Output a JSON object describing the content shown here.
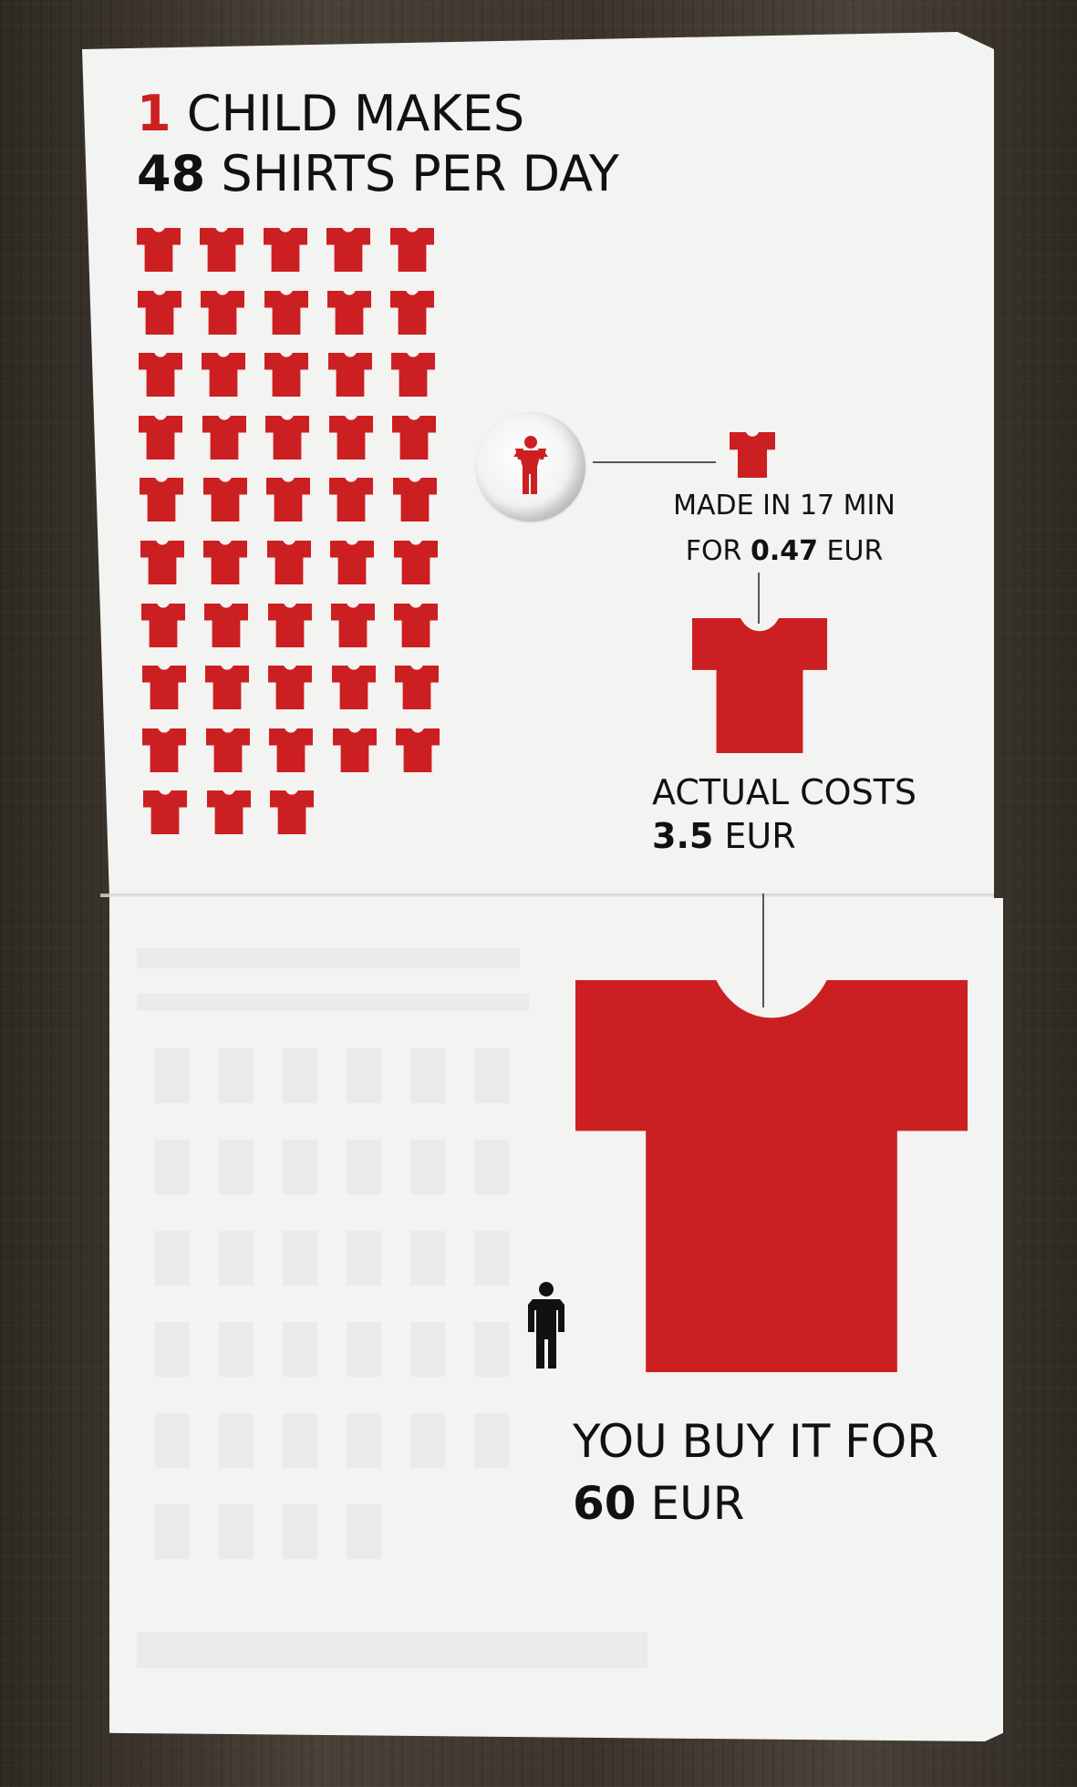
{
  "header": {
    "line1_red_number": "1",
    "line1_rest": "CHILD MAKES",
    "line2_number": "48",
    "line2_rest": "SHIRTS PER DAY"
  },
  "shirts": {
    "count": 48
  },
  "captions": {
    "made_line1": "MADE IN 17 MIN",
    "made_line2_prefix": "FOR",
    "made_line2_value": "0.47",
    "made_line2_suffix": "EUR",
    "actual_line1": "ACTUAL COSTS",
    "actual_line2_value": "3.5",
    "actual_line2_suffix": "EUR",
    "buy_line1": "YOU BUY IT FOR",
    "buy_line2_value": "60",
    "buy_line2_suffix": "EUR"
  },
  "colors": {
    "red": "#cc1f22",
    "paper": "#f3f3f1",
    "text": "#111111"
  },
  "icons": {
    "child": "child-icon",
    "person": "person-icon",
    "shirt": "shirt-icon"
  }
}
